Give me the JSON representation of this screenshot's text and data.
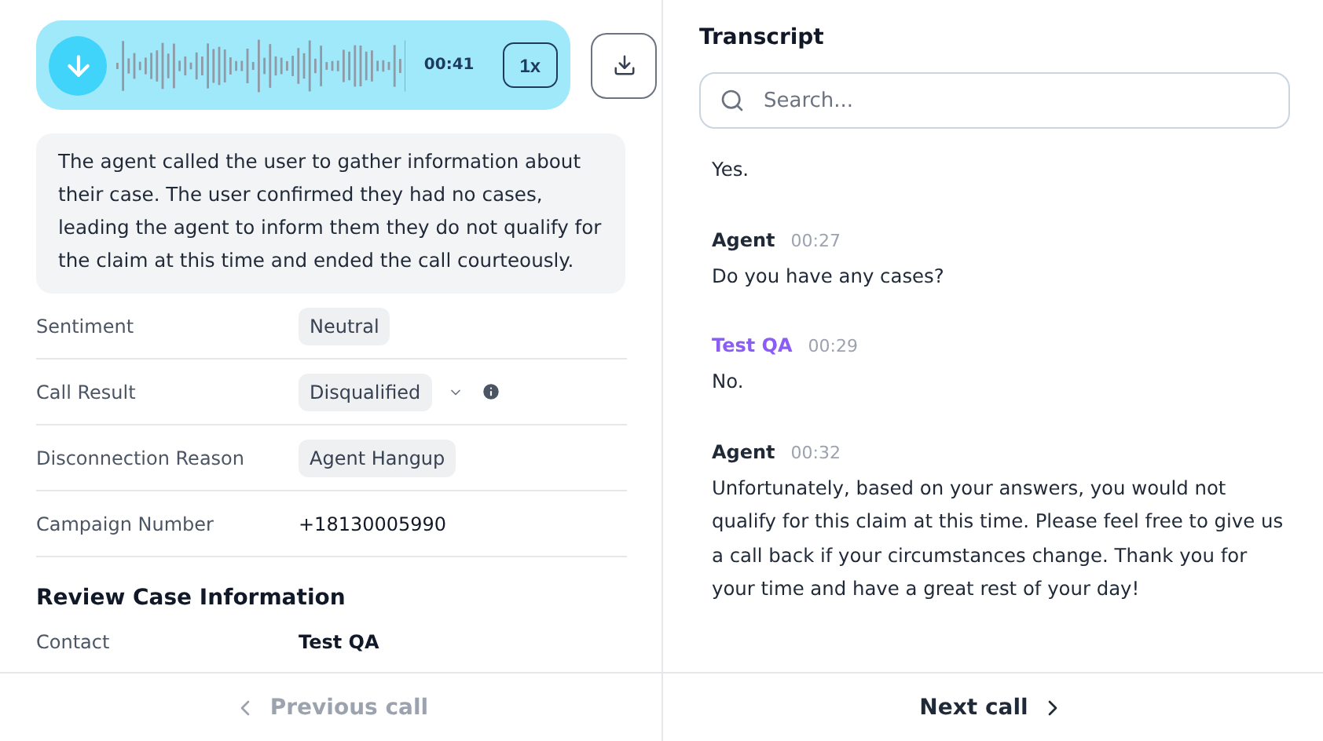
{
  "player": {
    "time": "00:41",
    "speed": "1x"
  },
  "summary": "The agent called the user to gather information about their case. The user confirmed they had no cases, leading the agent to inform them they do not qualify for the claim at this time and ended the call courteously.",
  "fields": [
    {
      "label": "Sentiment",
      "value": "Neutral",
      "kind": "chip"
    },
    {
      "label": "Call Result",
      "value": "Disqualified",
      "kind": "select"
    },
    {
      "label": "Disconnection Reason",
      "value": "Agent Hangup",
      "kind": "chip"
    },
    {
      "label": "Campaign Number",
      "value": "+18130005990",
      "kind": "text"
    }
  ],
  "case_section": {
    "title": "Review Case Information",
    "fields": [
      {
        "label": "Contact",
        "value": "Test QA"
      }
    ]
  },
  "transcript": {
    "title": "Transcript",
    "search": {
      "placeholder": "Search..."
    },
    "messages": [
      {
        "text": "Yes."
      },
      {
        "speaker": "Agent",
        "kind": "agent",
        "time": "00:27",
        "text": "Do you have any cases?"
      },
      {
        "speaker": "Test QA",
        "kind": "user",
        "time": "00:29",
        "text": "No."
      },
      {
        "speaker": "Agent",
        "kind": "agent",
        "time": "00:32",
        "text": "Unfortunately, based on your answers, you would not qualify for this claim at this time. Please feel free to give us a call back if your circumstances change. Thank you for your time and have a great rest of your day!"
      }
    ]
  },
  "nav": {
    "previous": {
      "label": "Previous call",
      "disabled": true
    },
    "next": {
      "label": "Next call",
      "disabled": false
    }
  }
}
